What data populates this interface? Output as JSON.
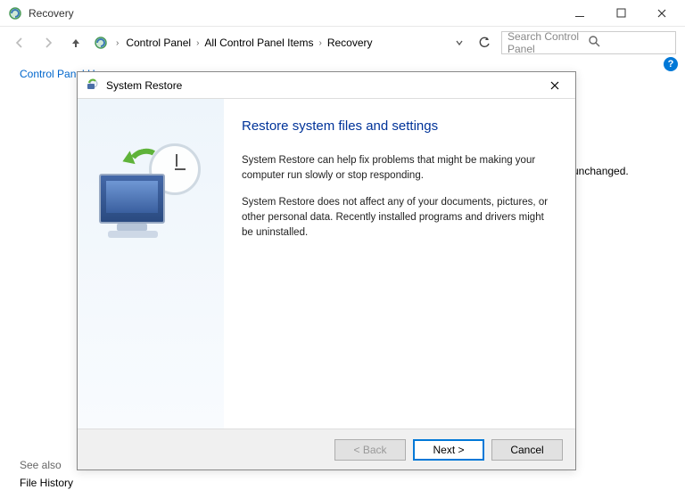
{
  "window": {
    "title": "Recovery",
    "min_tip": "Minimize",
    "max_tip": "Maximize",
    "close_tip": "Close"
  },
  "nav": {
    "back_tip": "Back",
    "forward_tip": "Forward",
    "up_tip": "Up",
    "breadcrumb": [
      "Control Panel",
      "All Control Panel Items",
      "Recovery"
    ],
    "refresh_tip": "Refresh",
    "search_placeholder": "Search Control Panel"
  },
  "panel": {
    "home_link": "Control Panel Home",
    "bg_fragment": "ic unchanged.",
    "help_tip": "Help",
    "see_also_label": "See also",
    "file_history_link": "File History"
  },
  "dialog": {
    "title": "System Restore",
    "close_tip": "Close",
    "heading": "Restore system files and settings",
    "para1": "System Restore can help fix problems that might be making your computer run slowly or stop responding.",
    "para2": "System Restore does not affect any of your documents, pictures, or other personal data. Recently installed programs and drivers might be uninstalled.",
    "back_btn": "< Back",
    "next_btn": "Next >",
    "cancel_btn": "Cancel"
  }
}
